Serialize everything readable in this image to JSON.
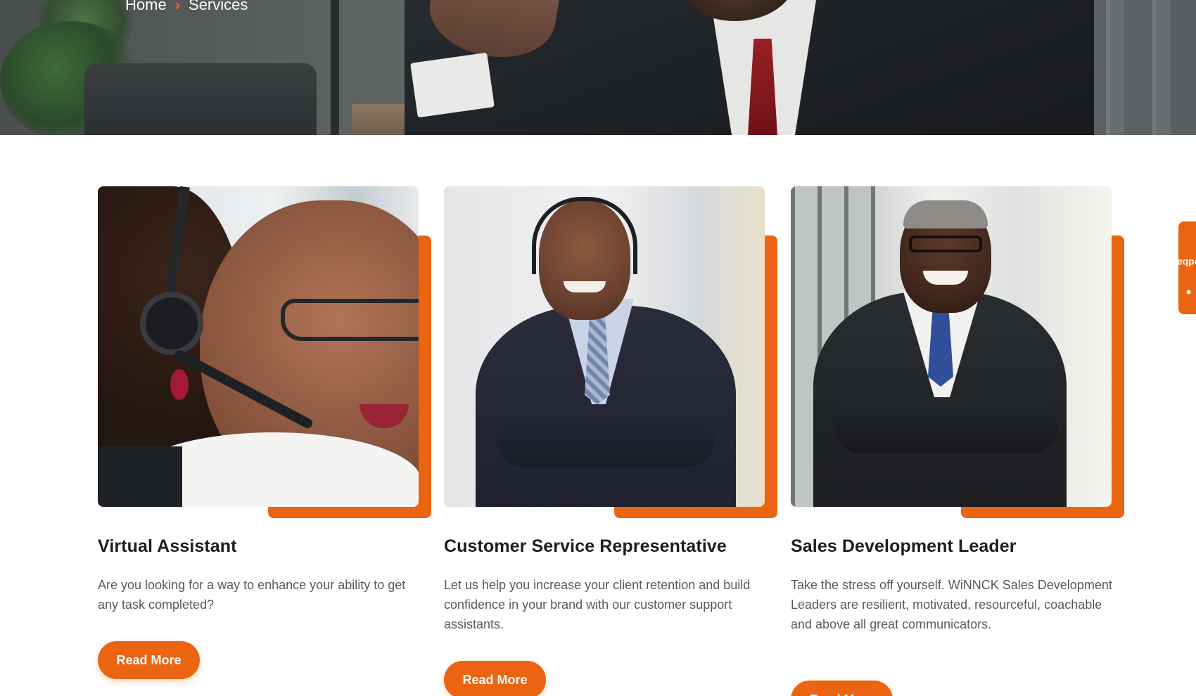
{
  "breadcrumb": {
    "home_label": "Home",
    "separator": "›",
    "current_label": "Services"
  },
  "theme": {
    "accent": "#ea6411",
    "heading_color": "#1e1e1e",
    "body_text_color": "#555a5e"
  },
  "services": [
    {
      "title": "Virtual Assistant",
      "description": "Are you looking for a way to enhance your ability to get any task completed?",
      "button_label": "Read More"
    },
    {
      "title": "Customer Service Representative",
      "description": "Let us help you increase your client retention and build confidence in your brand with our customer support assistants.",
      "button_label": "Read More"
    },
    {
      "title": "Sales Development Leader",
      "description": "Take the stress off yourself. WiNNCK Sales Development Leaders are resilient, motivated, resourceful, coachable and above all great communicators.",
      "button_label": "Read More"
    }
  ],
  "feedback_tab": {
    "label": "Feedback",
    "icon": "person-icon"
  }
}
